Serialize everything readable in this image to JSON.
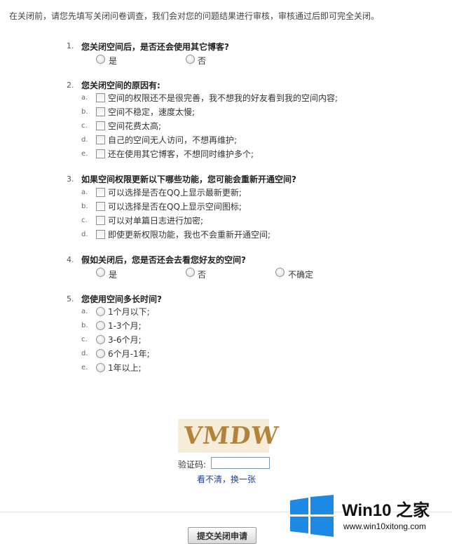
{
  "intro": "在关闭前，请您先填写关闭问卷调查，我们会对您的问题结果进行审核，审核通过后即可完全关闭。",
  "questions": [
    {
      "number": "1.",
      "title": "您关闭空间后，是否还会使用其它博客?",
      "type": "radio-inline",
      "options": [
        {
          "label": "是"
        },
        {
          "label": "否"
        }
      ]
    },
    {
      "number": "2.",
      "title": "您关闭空间的原因有:",
      "type": "checkbox",
      "options": [
        {
          "letter": "a.",
          "label": "空间的权限还不是很完善，我不想我的好友看到我的空间内容;"
        },
        {
          "letter": "b.",
          "label": "空间不稳定，速度太慢;"
        },
        {
          "letter": "c.",
          "label": "空间花费太高;"
        },
        {
          "letter": "d.",
          "label": "自己的空间无人访问，不想再维护;"
        },
        {
          "letter": "e.",
          "label": "还在使用其它博客，不想同时维护多个;"
        }
      ]
    },
    {
      "number": "3.",
      "title": "如果空间权限更新以下哪些功能，您可能会重新开通空间?",
      "type": "checkbox",
      "options": [
        {
          "letter": "a.",
          "label": "可以选择是否在QQ上显示最新更新;"
        },
        {
          "letter": "b.",
          "label": "可以选择是否在QQ上显示空间图标;"
        },
        {
          "letter": "c.",
          "label": "可以对单篇日志进行加密;"
        },
        {
          "letter": "d.",
          "label": "即使更新权限功能，我也不会重新开通空间;"
        }
      ]
    },
    {
      "number": "4.",
      "title": "假如关闭后，您是否还会去看您好友的空间?",
      "type": "radio-inline",
      "options": [
        {
          "label": "是"
        },
        {
          "label": "否"
        },
        {
          "label": "不确定"
        }
      ]
    },
    {
      "number": "5.",
      "title": "您使用空间多长时间?",
      "type": "radio-list",
      "options": [
        {
          "letter": "a.",
          "label": "1个月以下;"
        },
        {
          "letter": "b.",
          "label": "1-3个月;"
        },
        {
          "letter": "c.",
          "label": "3-6个月;"
        },
        {
          "letter": "d.",
          "label": "6个月-1年;"
        },
        {
          "letter": "e.",
          "label": "1年以上;"
        }
      ]
    }
  ],
  "captcha": {
    "image_text": "VMDW",
    "label": "验证码:",
    "input_value": "",
    "refresh_link": "看不清，换一张"
  },
  "submit_label": "提交关闭申请",
  "watermark": {
    "title": "Win10 之家",
    "url": "www.win10xitong.com",
    "logo_colors": [
      "#1e88e5",
      "#1e88e5",
      "#1e88e5",
      "#1e88e5"
    ]
  }
}
